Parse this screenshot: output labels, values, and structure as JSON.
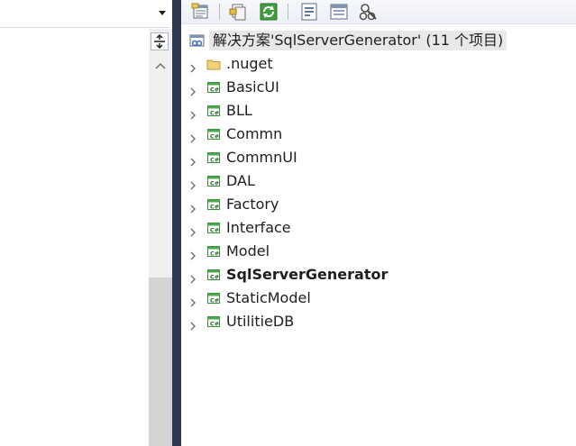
{
  "solution": {
    "title": "解决方案'SqlServerGenerator' (11 个项目)"
  },
  "projects": [
    {
      "label": ".nuget",
      "icon": "folder-icon",
      "startup": false
    },
    {
      "label": "BasicUI",
      "icon": "csharp-project-icon",
      "startup": false
    },
    {
      "label": "BLL",
      "icon": "csharp-project-icon",
      "startup": false
    },
    {
      "label": "Commn",
      "icon": "csharp-project-icon",
      "startup": false
    },
    {
      "label": "CommnUI",
      "icon": "csharp-project-icon",
      "startup": false
    },
    {
      "label": "DAL",
      "icon": "csharp-project-icon",
      "startup": false
    },
    {
      "label": "Factory",
      "icon": "csharp-project-icon",
      "startup": false
    },
    {
      "label": "Interface",
      "icon": "csharp-project-icon",
      "startup": false
    },
    {
      "label": "Model",
      "icon": "csharp-project-icon",
      "startup": false
    },
    {
      "label": "SqlServerGenerator",
      "icon": "csharp-project-icon",
      "startup": true
    },
    {
      "label": "StaticModel",
      "icon": "csharp-project-icon",
      "startup": false
    },
    {
      "label": "UtilitieDB",
      "icon": "csharp-project-icon",
      "startup": false
    }
  ],
  "toolbar": {
    "buttons": [
      "properties-icon",
      "show-all-files-icon",
      "refresh-icon",
      "view-code-icon",
      "view-designer-icon",
      "class-view-icon"
    ]
  },
  "colors": {
    "splitter": "#2d3a52",
    "selection": "#e8e8e8",
    "project_green": "#3a9a3a"
  }
}
